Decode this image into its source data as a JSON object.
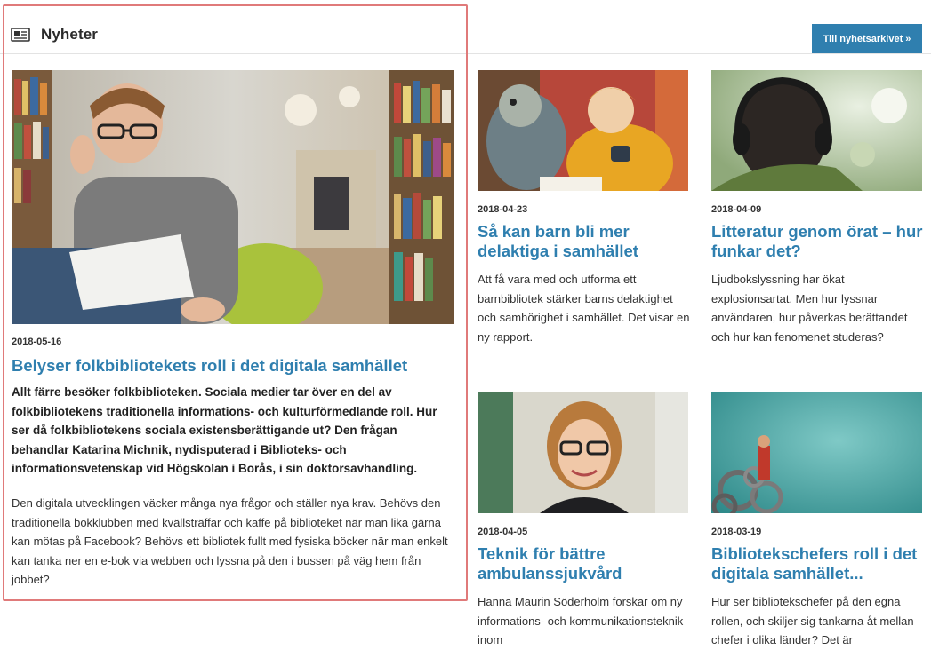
{
  "section": {
    "title": "Nyheter",
    "icon": "newspaper-icon",
    "archive_button": "Till nyhetsarkivet »"
  },
  "featured": {
    "date": "2018-05-16",
    "title": "Belyser folkbibliotekets roll i det digitala samhället",
    "lead": "Allt färre besöker folkbiblioteken. Sociala medier tar över en del av folkbibliotekens traditionella informations- och kulturförmedlande roll. Hur ser då folkbibliotekens sociala existensberättigande ut? Den frågan behandlar Katarina Michnik, nydisputerad i Biblioteks- och informationsvetenskap vid Högskolan i Borås, i sin doktorsavhandling.",
    "body": "Den digitala utvecklingen väcker många nya frågor och ställer nya krav. Behövs den traditionella bokklubben med kvällsträffar och kaffe på biblioteket när man lika gärna kan mötas på Facebook? Behövs ett bibliotek fullt med fysiska böcker när man enkelt kan tanka ner en e-bok via webben och lyssna på den i bussen på väg hem från jobbet?"
  },
  "articles": [
    {
      "date": "2018-04-23",
      "title": "Så kan barn bli mer delaktiga i samhället",
      "text": "Att få vara med och utforma ett barnbibliotek stärker barns delaktighet och samhörighet i samhället. Det visar en ny rapport."
    },
    {
      "date": "2018-04-09",
      "title": "Litteratur genom örat – hur funkar det?",
      "text": "Ljudbokslyssning har ökat explosionsartat. Men hur lyssnar användaren, hur påverkas berättandet och hur kan fenomenet studeras?"
    },
    {
      "date": "2018-04-05",
      "title": "Teknik för bättre ambulanssjukvård",
      "text": "Hanna Maurin Söderholm forskar om ny informations- och kommunikationsteknik inom"
    },
    {
      "date": "2018-03-19",
      "title": "Bibliotekschefers roll i det digitala samhället...",
      "text": "Hur ser bibliotekschefer på den egna rollen, och skiljer sig tankarna åt mellan chefer i olika länder? Det är"
    }
  ],
  "colors": {
    "accent": "#2f7faf",
    "highlight_border": "#e07a7a"
  }
}
